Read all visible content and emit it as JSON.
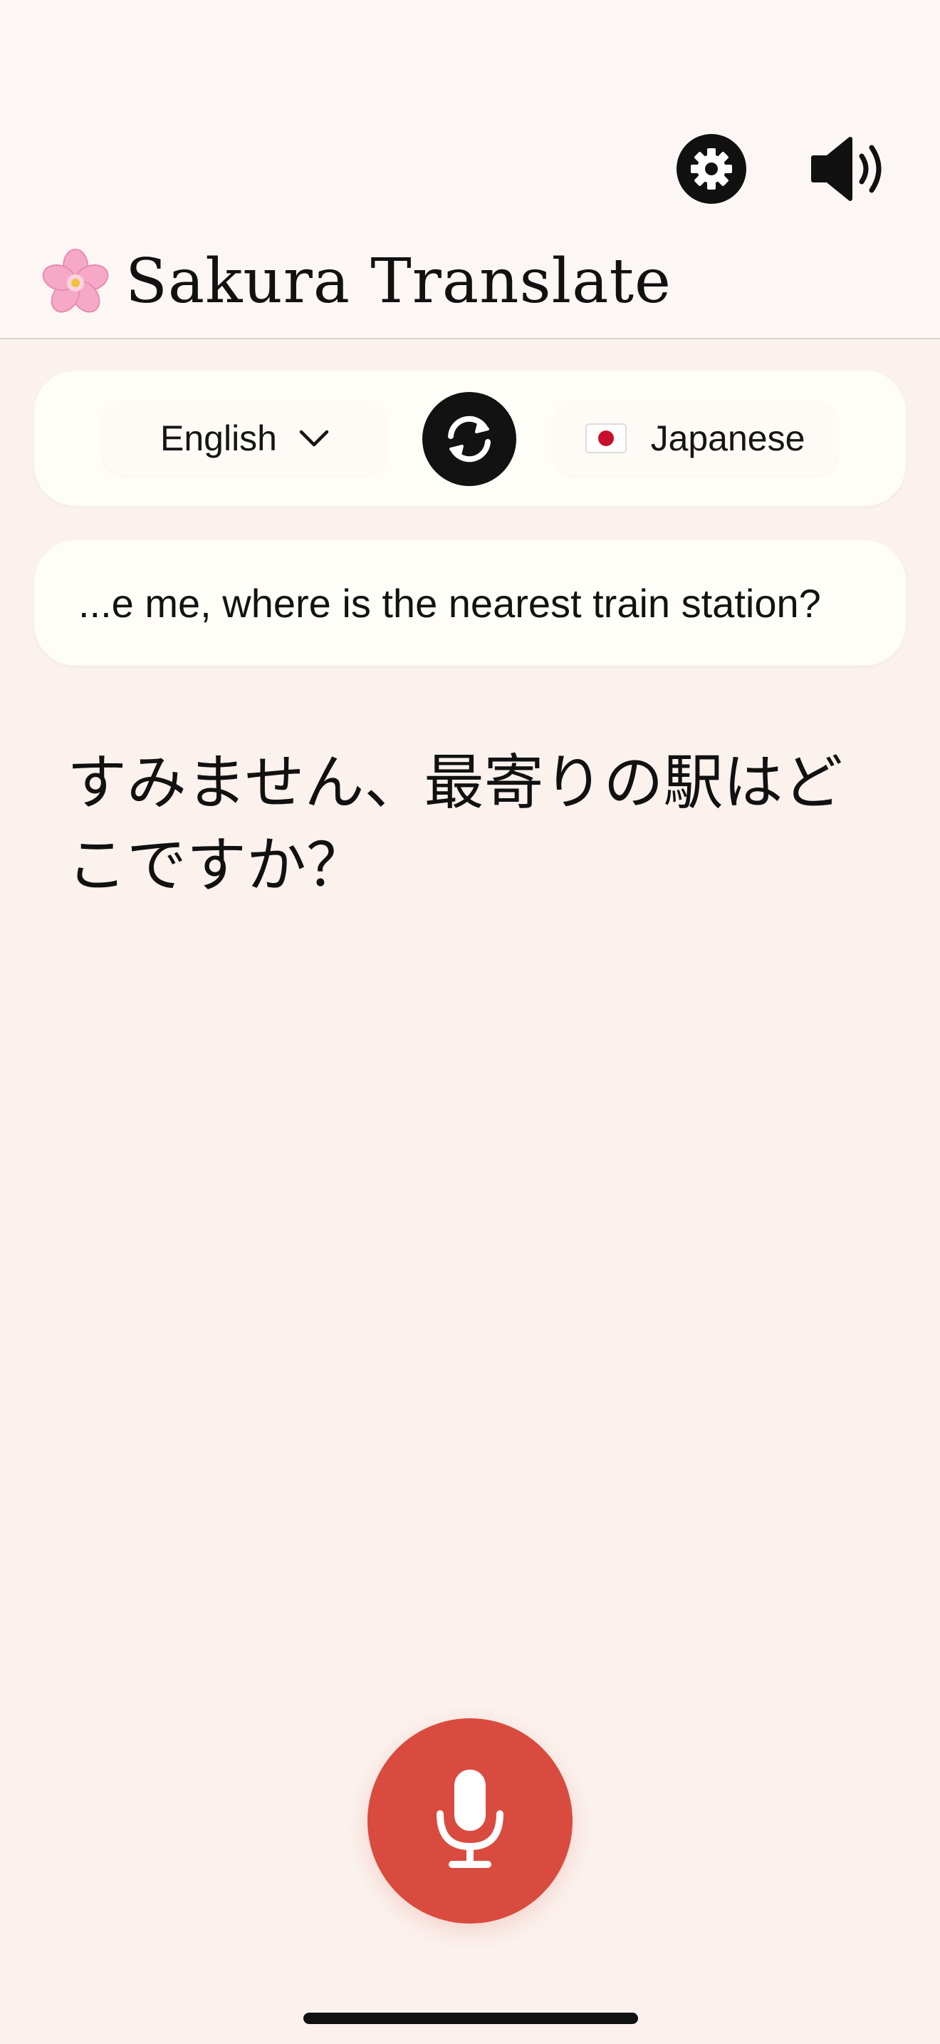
{
  "header": {
    "title": "Sakura Translate",
    "logo_icon": "cherry-blossom-icon",
    "settings_icon": "gear-icon",
    "sound_icon": "speaker-icon"
  },
  "languages": {
    "source": "English",
    "target": "Japanese",
    "source_icon": "chevron-down-icon",
    "target_icon": "japan-flag-icon",
    "swap_icon": "swap-arrows-icon"
  },
  "input": {
    "text": "...e me, where is the nearest train station?"
  },
  "translation": {
    "text": "すみません、最寄りの駅はどこですか？"
  },
  "mic": {
    "icon": "microphone-icon",
    "color": "#d94b3e"
  },
  "colors": {
    "background": "#fbf1ed",
    "header_background": "#fcf6f4",
    "card_background": "#fffdf8",
    "dark": "#111111"
  }
}
